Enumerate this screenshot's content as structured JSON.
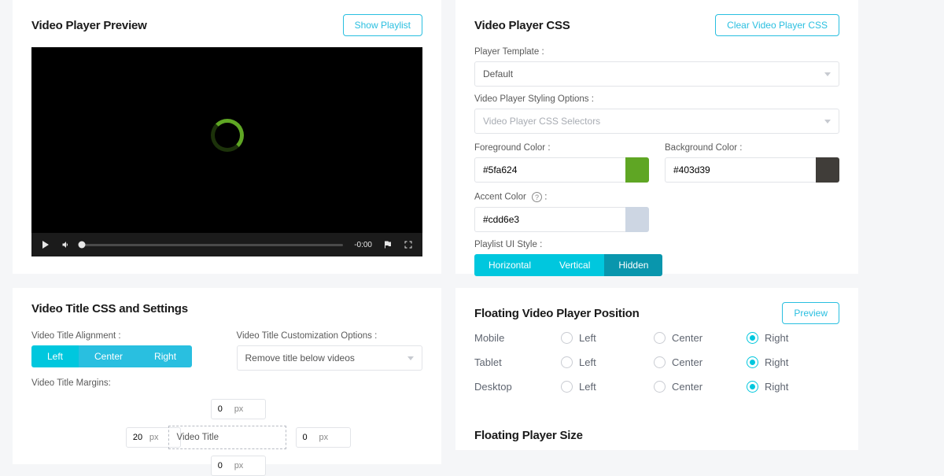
{
  "preview": {
    "title": "Video Player Preview",
    "show_playlist": "Show Playlist",
    "time": "-0:00"
  },
  "css": {
    "title": "Video Player CSS",
    "clear": "Clear Video Player CSS",
    "template_label": "Player Template :",
    "template_value": "Default",
    "styling_label": "Video Player Styling Options :",
    "styling_placeholder": "Video Player CSS Selectors",
    "fg_label": "Foreground Color :",
    "fg_value": "#5fa624",
    "bg_label": "Background Color :",
    "bg_value": "#403d39",
    "accent_label": "Accent Color",
    "accent_value": "#cdd6e3",
    "playlist_label": "Playlist UI Style :",
    "seg": {
      "horizontal": "Horizontal",
      "vertical": "Vertical",
      "hidden": "Hidden"
    }
  },
  "titlecss": {
    "title": "Video Title CSS and Settings",
    "align_label": "Video Title Alignment :",
    "align": {
      "left": "Left",
      "center": "Center",
      "right": "Right"
    },
    "custom_label": "Video Title Customization Options :",
    "custom_value": "Remove title below videos",
    "margins_label": "Video Title Margins:",
    "margins": {
      "top": "0",
      "left": "20",
      "right": "0",
      "bottom": "0",
      "unit": "px",
      "box": "Video Title"
    }
  },
  "floatpos": {
    "title": "Floating Video Player Position",
    "preview": "Preview",
    "rows": [
      "Mobile",
      "Tablet",
      "Desktop"
    ],
    "opts": [
      "Left",
      "Center",
      "Right"
    ]
  },
  "floatsize": {
    "title": "Floating Player Size"
  }
}
